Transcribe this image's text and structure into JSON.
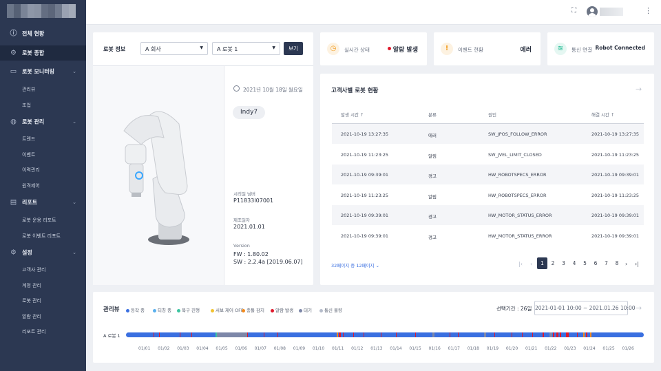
{
  "sidebar": {
    "nav": [
      {
        "label": "전체 현황",
        "icon": "info-icon"
      },
      {
        "label": "로봇 종합",
        "icon": "robot-arm-icon",
        "active": true
      },
      {
        "label": "로봇 모니터링",
        "icon": "monitor-icon",
        "children": [
          "관리뷰",
          "조업"
        ]
      },
      {
        "label": "로봇 관리",
        "icon": "globe-icon",
        "children": [
          "트렌드",
          "이벤트",
          "이력관리",
          "원격제어"
        ]
      },
      {
        "label": "리포트",
        "icon": "report-icon",
        "children": [
          "로봇 운용 리포트",
          "로봇 이벤트 리포트"
        ]
      },
      {
        "label": "설정",
        "icon": "gear-icon",
        "children": [
          "고객사 관리",
          "계정 관리",
          "로봇 관리",
          "알람 관리",
          "리포트 관리"
        ]
      }
    ]
  },
  "header": {
    "fullscreen_icon": "fullscreen-icon",
    "avatar_icon": "user-avatar-icon",
    "menu_icon": "kebab-menu-icon"
  },
  "robot_info": {
    "title": "로봇 정보",
    "company_select": "A 회사",
    "robot_select": "A 로봇 1",
    "view_button": "보기",
    "date": "2021년 10월 18일 월요일",
    "model": "Indy7",
    "serial_label": "시리얼 넘버",
    "serial": "P11833I07001",
    "mfg_label": "제조일자",
    "mfg_date": "2021.01.01",
    "version_label": "Version",
    "fw": "FW : 1.80.02",
    "sw": "SW : 2.2.4a [2019.06.07]"
  },
  "status_cards": [
    {
      "label": "실시간 상태",
      "value": "알람 발생",
      "icon": "clock-icon",
      "icon_color": "#f29b1d",
      "dot_color": "#e0192c"
    },
    {
      "label": "이벤트 현황",
      "value": "에러",
      "icon": "alert-icon",
      "icon_color": "#f29b1d"
    },
    {
      "label": "통신 연결",
      "value": "Robot Connected",
      "icon": "wifi-icon",
      "icon_color": "#3cc4a0"
    }
  ],
  "customer_status": {
    "title": "고객사별 로봇 현황",
    "columns": [
      "발생 시간 ↑",
      "분류",
      "원인",
      "해결 시간 ↑"
    ],
    "rows": [
      [
        "2021-10-19 13:27:35",
        "에러",
        "SW_JPOS_FOLLOW_ERROR",
        "2021-10-19 13:27:35"
      ],
      [
        "2021-10-19 11:23:25",
        "알림",
        "SW_JVEL_LIMIT_CLOSED",
        "2021-10-19 11:23:25"
      ],
      [
        "2021-10-19 09:39:01",
        "경고",
        "HW_ROBOTSPECS_ERROR",
        "2021-10-19 09:39:01"
      ],
      [
        "2021-10-19 11:23:25",
        "알림",
        "HW_ROBOTSPECS_ERROR",
        "2021-10-19 11:23:25"
      ],
      [
        "2021-10-19 09:39:01",
        "경고",
        "HW_MOTOR_STATUS_ERROR",
        "2021-10-19 09:39:01"
      ],
      [
        "2021-10-19 09:39:01",
        "경고",
        "HW_MOTOR_STATUS_ERROR",
        "2021-10-19 09:39:01"
      ]
    ],
    "page_size": "32페이지 중 12페이지",
    "pages": [
      "1",
      "2",
      "3",
      "4",
      "5",
      "6",
      "7",
      "8"
    ],
    "current_page": "1"
  },
  "timeline": {
    "title": "관리뷰",
    "legend": [
      {
        "label": "동작 중",
        "color": "#3a6fe0"
      },
      {
        "label": "티칭 중",
        "color": "#5ab0ee"
      },
      {
        "label": "복구 진행",
        "color": "#3cc4a0"
      },
      {
        "label": "서보 제어 OFF",
        "color": "#f2c230"
      },
      {
        "label": "충돌 감지",
        "color": "#f28a1d"
      },
      {
        "label": "알람 발생",
        "color": "#e0192c"
      },
      {
        "label": "대기",
        "color": "#7d87a8"
      },
      {
        "label": "통신 불량",
        "color": "#b5bccb"
      }
    ],
    "period_label": "선택기간 : 26일",
    "period_range": "2021-01-01  10:00 ~ 2021.01.26  10:00",
    "robot_label": "A 로봇 1",
    "ticks": [
      "01/01",
      "01/02",
      "01/03",
      "01/04",
      "01/05",
      "01/06",
      "01/07",
      "01/08",
      "01/09",
      "01/10",
      "01/11",
      "01/12",
      "01/13",
      "01/14",
      "01/15",
      "01/16",
      "01/17",
      "01/18",
      "01/19",
      "01/20",
      "01/21",
      "01/22",
      "01/23",
      "01/24",
      "01/25",
      "01/26"
    ]
  }
}
